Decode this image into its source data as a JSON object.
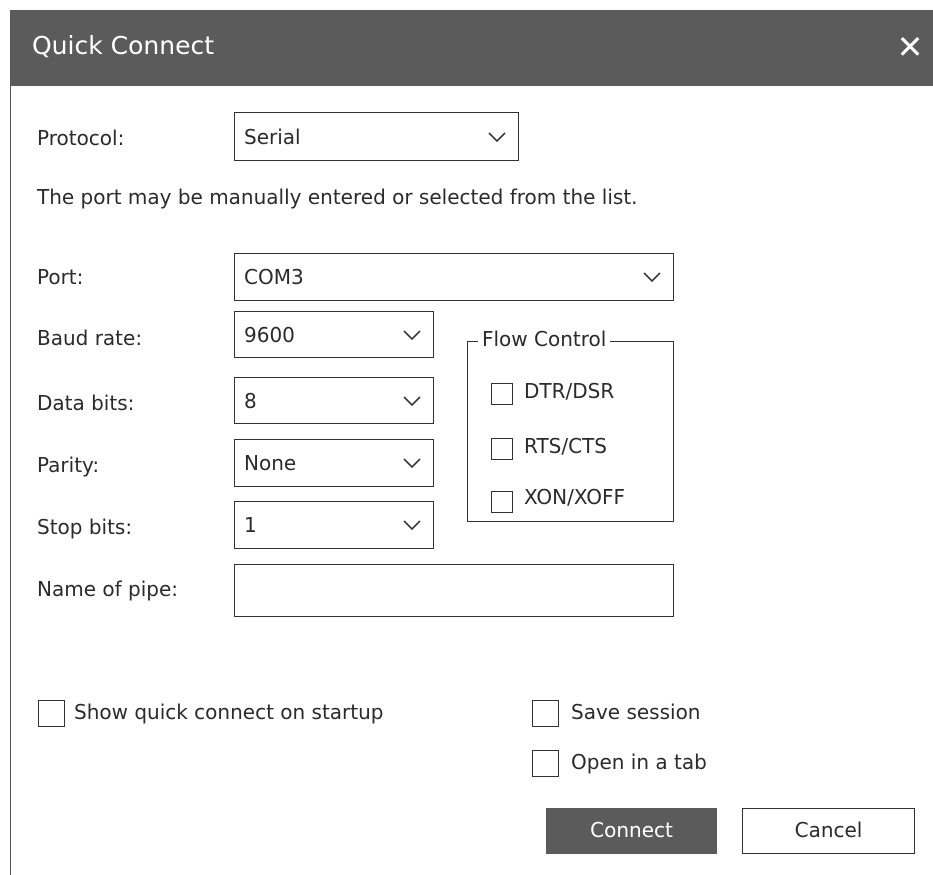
{
  "window": {
    "title": "Quick Connect",
    "close_glyph": "✕"
  },
  "protocol": {
    "label": "Protocol:",
    "value": "Serial"
  },
  "hint": "The port may be manually entered or selected from the list.",
  "port": {
    "label": "Port:",
    "value": "COM3"
  },
  "baud_rate": {
    "label": "Baud rate:",
    "value": "9600"
  },
  "data_bits": {
    "label": "Data bits:",
    "value": "8"
  },
  "parity": {
    "label": "Parity:",
    "value": "None"
  },
  "stop_bits": {
    "label": "Stop bits:",
    "value": "1"
  },
  "name_of_pipe": {
    "label": "Name of pipe:",
    "value": ""
  },
  "flow_control": {
    "legend": "Flow Control",
    "options": [
      {
        "label": "DTR/DSR",
        "checked": false
      },
      {
        "label": "RTS/CTS",
        "checked": false
      },
      {
        "label": "XON/XOFF",
        "checked": false
      }
    ]
  },
  "options": {
    "show_on_startup": {
      "label": "Show quick connect on startup",
      "checked": false
    },
    "save_session": {
      "label": "Save session",
      "checked": false
    },
    "open_in_tab": {
      "label": "Open in a tab",
      "checked": false
    }
  },
  "buttons": {
    "connect": "Connect",
    "cancel": "Cancel"
  },
  "colors": {
    "titlebar": "#5b5b5b",
    "primary_button": "#5b5b5b",
    "text": "#2b2b2b",
    "border": "#333333"
  }
}
